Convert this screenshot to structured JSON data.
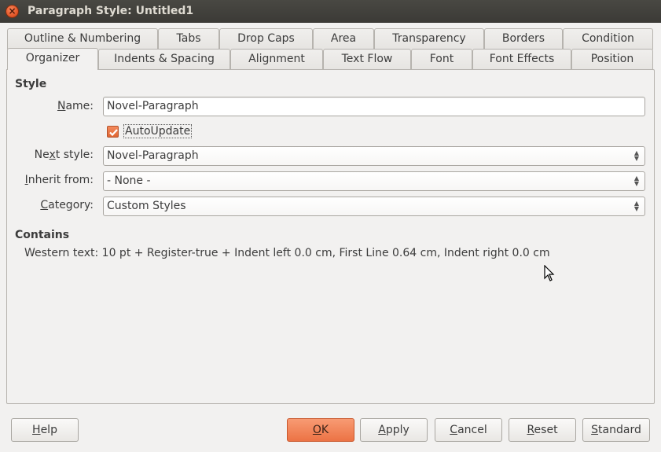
{
  "window": {
    "title": "Paragraph Style: Untitled1",
    "close_glyph": "×"
  },
  "tabs": {
    "row1": [
      {
        "label": "Outline & Numbering"
      },
      {
        "label": "Tabs"
      },
      {
        "label": "Drop Caps"
      },
      {
        "label": "Area"
      },
      {
        "label": "Transparency"
      },
      {
        "label": "Borders"
      },
      {
        "label": "Condition"
      }
    ],
    "row2": [
      {
        "label": "Organizer",
        "active": true
      },
      {
        "label": "Indents & Spacing"
      },
      {
        "label": "Alignment"
      },
      {
        "label": "Text Flow"
      },
      {
        "label": "Font"
      },
      {
        "label": "Font Effects"
      },
      {
        "label": "Position"
      }
    ]
  },
  "style_section": {
    "heading": "Style",
    "name_label_ul": "N",
    "name_label_rest": "ame:",
    "name_value": "Novel-Paragraph",
    "autoupdate_label": "AutoUpdate",
    "autoupdate_checked": true,
    "next_label_pre": "Ne",
    "next_label_ul": "x",
    "next_label_rest": "t style:",
    "next_value": "Novel-Paragraph",
    "inherit_label_ul": "I",
    "inherit_label_rest": "nherit from:",
    "inherit_value": "- None -",
    "category_label_ul": "C",
    "category_label_rest": "ategory:",
    "category_value": "Custom Styles"
  },
  "contains_section": {
    "heading": "Contains",
    "text": "Western text: 10 pt + Register-true + Indent left 0.0 cm, First Line 0.64 cm, Indent right 0.0 cm"
  },
  "buttons": {
    "help": {
      "ul": "H",
      "rest": "elp"
    },
    "ok": {
      "ul": "O",
      "rest": "K"
    },
    "apply": {
      "ul": "A",
      "rest": "pply"
    },
    "cancel": {
      "ul": "C",
      "rest": "ancel"
    },
    "reset": {
      "ul": "R",
      "rest": "eset"
    },
    "standard": {
      "ul": "S",
      "rest": "tandard"
    }
  },
  "colors": {
    "accent": "#ec7345",
    "titlebar": "#3b3a36",
    "background": "#f2f1f0"
  }
}
